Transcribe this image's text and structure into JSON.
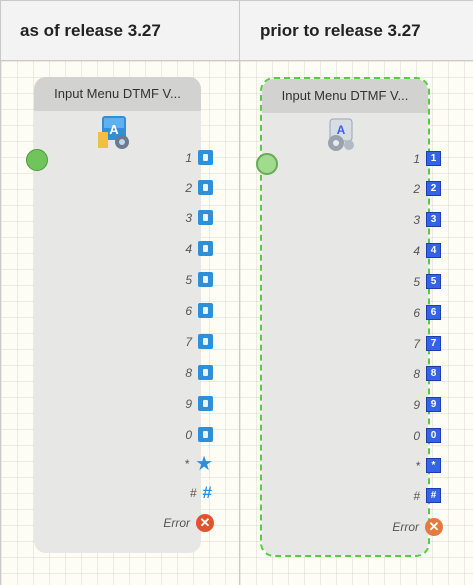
{
  "headers": [
    "as of release 3.27",
    "prior to release 3.27"
  ],
  "node": {
    "title": "Input Menu DTMF V..."
  },
  "outputs": [
    "1",
    "2",
    "3",
    "4",
    "5",
    "6",
    "7",
    "8",
    "9",
    "0",
    "*",
    "#"
  ],
  "error_label": "Error",
  "old_glyphs": [
    "1",
    "2",
    "3",
    "4",
    "5",
    "6",
    "7",
    "8",
    "9",
    "0",
    "*",
    "#"
  ],
  "colors": {
    "port_new": "#2f8fd8",
    "port_old": "#3563e6",
    "input_port": "#6fc45a",
    "error": "#e0532f",
    "selection": "#55cc44"
  },
  "icons": {
    "new_node": "input-menu-dtmf-icon",
    "old_node": "input-menu-dtmf-gear-icon"
  }
}
